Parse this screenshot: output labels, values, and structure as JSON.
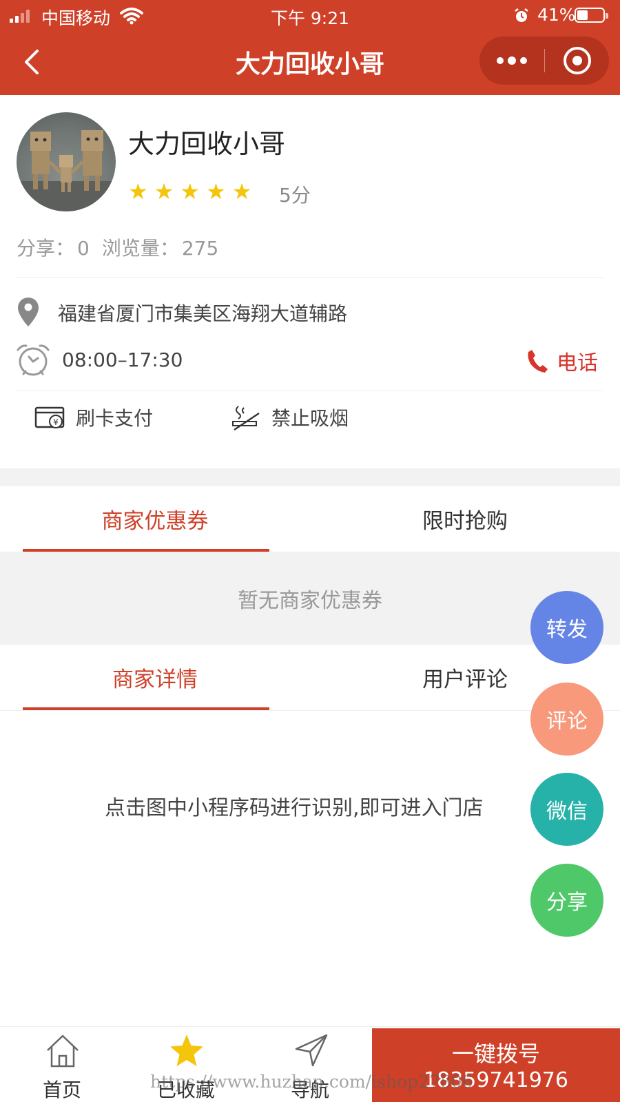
{
  "status_bar": {
    "carrier": "中国移动",
    "time": "下午 9:21",
    "battery": "41%",
    "battery_level": 0.41
  },
  "nav": {
    "title": "大力回收小哥"
  },
  "shop": {
    "name": "大力回收小哥",
    "rating_stars": 5,
    "score": "5分",
    "share_label": "分享：",
    "share_count": "0",
    "views_label": "浏览量：",
    "views_count": "275",
    "address": "福建省厦门市集美区海翔大道辅路",
    "hours": "08:00–17:30",
    "phone_label": "电话",
    "features": [
      {
        "label": "刷卡支付",
        "icon": "card-payment-icon"
      },
      {
        "label": "禁止吸烟",
        "icon": "no-smoking-icon"
      }
    ]
  },
  "coupon_tabs": {
    "items": [
      "商家优惠券",
      "限时抢购"
    ],
    "active": 0,
    "empty_text": "暂无商家优惠券"
  },
  "detail_tabs": {
    "items": [
      "商家详情",
      "用户评论"
    ],
    "active": 0,
    "content": "点击图中小程序码进行识别,即可进入门店"
  },
  "float_buttons": [
    {
      "label": "转发",
      "color": "#6485e6"
    },
    {
      "label": "评论",
      "color": "#f7997a"
    },
    {
      "label": "微信",
      "color": "#26b2a8"
    },
    {
      "label": "分享",
      "color": "#4fc86a"
    }
  ],
  "bottom_bar": {
    "home": "首页",
    "favorited": "已收藏",
    "navigate": "导航",
    "dial_title": "一键拨号",
    "dial_number": "18359741976"
  },
  "watermark": "https://www.huzhan.com/ishop27806",
  "colors": {
    "primary": "#cf4028",
    "star": "#f5c50c",
    "phone": "#d8342b"
  }
}
